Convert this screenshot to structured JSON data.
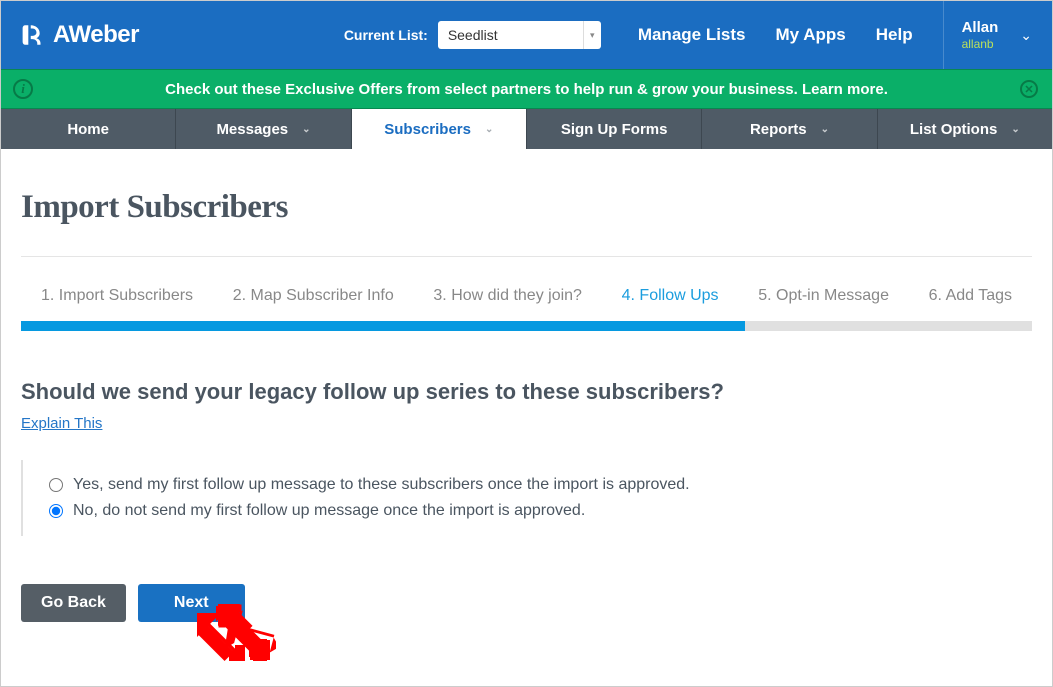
{
  "header": {
    "brand": "AWeber",
    "list_label": "Current List:",
    "list_value": "Seedlist",
    "links": {
      "manage": "Manage Lists",
      "apps": "My Apps",
      "help": "Help"
    },
    "user": {
      "name": "Allan",
      "sub": "allanb"
    }
  },
  "banner": {
    "pre": "Check out these ",
    "offers": "Exclusive Offers",
    "mid": " from select partners to help run & grow your business. ",
    "learn": "Learn more"
  },
  "nav": {
    "home": "Home",
    "messages": "Messages",
    "subscribers": "Subscribers",
    "signup": "Sign Up Forms",
    "reports": "Reports",
    "list_options": "List Options"
  },
  "page": {
    "title": "Import Subscribers",
    "steps": {
      "s1": "1. Import Subscribers",
      "s2": "2. Map Subscriber Info",
      "s3": "3. How did they join?",
      "s4": "4. Follow Ups",
      "s5": "5. Opt-in Message",
      "s6": "6. Add Tags"
    },
    "question": "Should we send your legacy follow up series to these subscribers?",
    "explain": "Explain This",
    "option_yes": "Yes, send my first follow up message to these subscribers once the import is approved.",
    "option_no": "No, do not send my first follow up message once the import is approved.",
    "btn_back": "Go Back",
    "btn_next": "Next"
  }
}
